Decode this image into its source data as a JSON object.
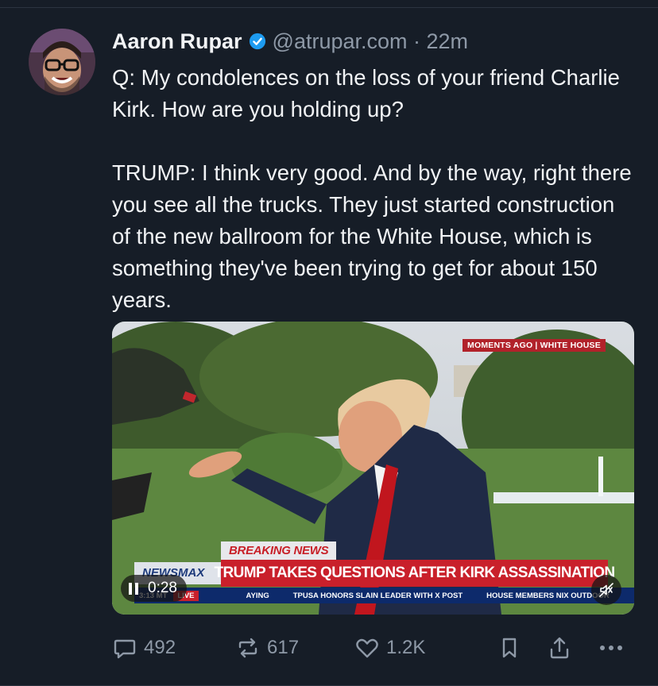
{
  "author": {
    "name": "Aaron Rupar",
    "handle": "@atrupar.com · 22m"
  },
  "tweet": {
    "text": "Q: My condolences on the loss of your friend Charlie Kirk. How are you holding up?\n\nTRUMP: I think very good. And by the way, right there you see all the trucks. They just started construction of the new ballroom for the White House, which is something they've been trying to get for about 150 years."
  },
  "video": {
    "corner_tag": "MOMENTS AGO | WHITE HOUSE",
    "breaking": "BREAKING NEWS",
    "headline": "TRUMP TAKES QUESTIONS AFTER KIRK ASSASSINATION",
    "network": "NEWSMAX",
    "ticker": {
      "time": "3:13 MT",
      "live": "LIVE",
      "item1": "AYING",
      "item2": "TPUSA HONORS SLAIN LEADER WITH X POST",
      "item3": "HOUSE MEMBERS NIX OUTDOOR"
    },
    "elapsed": "0:28",
    "sound_icon": "muted-speaker-icon"
  },
  "actions": {
    "replies": "492",
    "reposts": "617",
    "likes": "1.2K"
  },
  "colors": {
    "background": "#161d27",
    "muted_text": "#8e99a7",
    "verified": "#1d9bf0",
    "news_red": "#c9202b",
    "ticker_blue": "#0d2a6b"
  }
}
